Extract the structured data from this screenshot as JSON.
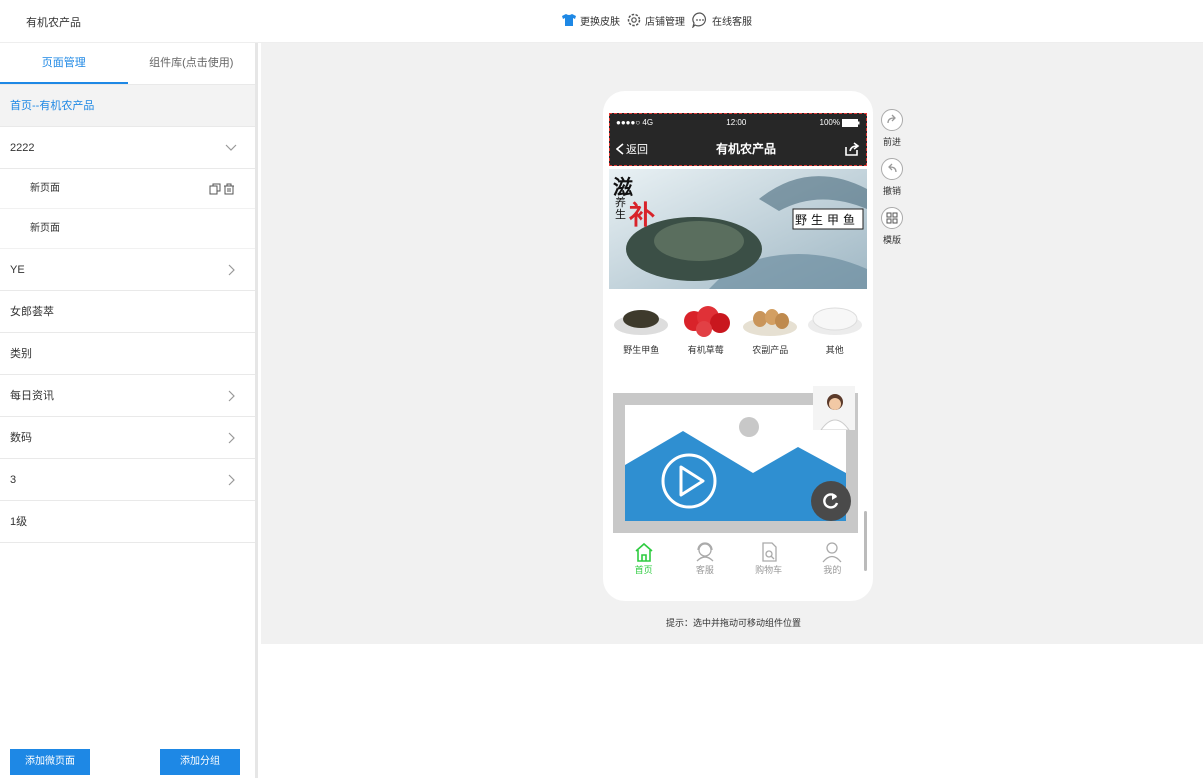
{
  "app": {
    "title": "有机农产品"
  },
  "top_actions": [
    {
      "label": "更换皮肤",
      "icon": "shirt-icon"
    },
    {
      "label": "店铺管理",
      "icon": "gear-icon"
    },
    {
      "label": "在线客服",
      "icon": "chat-icon"
    }
  ],
  "sidebar": {
    "tabs": [
      "页面管理",
      "组件库(点击使用)"
    ],
    "home_item": "首页--有机农产品",
    "group_2222": "2222",
    "sub_pages": [
      "新页面",
      "新页面"
    ],
    "items": [
      "YE",
      "女郎荟萃",
      "类别",
      "每日资讯",
      "数码",
      "3",
      "1级"
    ],
    "add_page_button": "添加微页面",
    "add_group_button": "添加分组"
  },
  "phone": {
    "status": {
      "carrier": "●●●●○ 4G",
      "time": "12:00",
      "battery": "100%"
    },
    "back_label": "返回",
    "page_title": "有机农产品",
    "banner": {
      "big_char_1": "滋",
      "small_chars": "养生",
      "big_char_2": "补",
      "product_tag": "野生甲鱼"
    },
    "categories": [
      "野生甲鱼",
      "有机草莓",
      "农副产品",
      "其他"
    ],
    "tabbar": [
      {
        "label": "首页",
        "icon": "home-icon"
      },
      {
        "label": "客服",
        "icon": "service-icon"
      },
      {
        "label": "购物车",
        "icon": "cart-icon"
      },
      {
        "label": "我的",
        "icon": "user-icon"
      }
    ]
  },
  "tools": [
    {
      "label": "前进",
      "icon": "redo-icon"
    },
    {
      "label": "撤销",
      "icon": "undo-icon"
    },
    {
      "label": "模版",
      "icon": "template-icon"
    }
  ],
  "hint": "提示：选中并拖动可移动组件位置",
  "colors": {
    "accent": "#1e88e5",
    "tab_active": "#2ecc40",
    "header_dark": "#272727"
  }
}
